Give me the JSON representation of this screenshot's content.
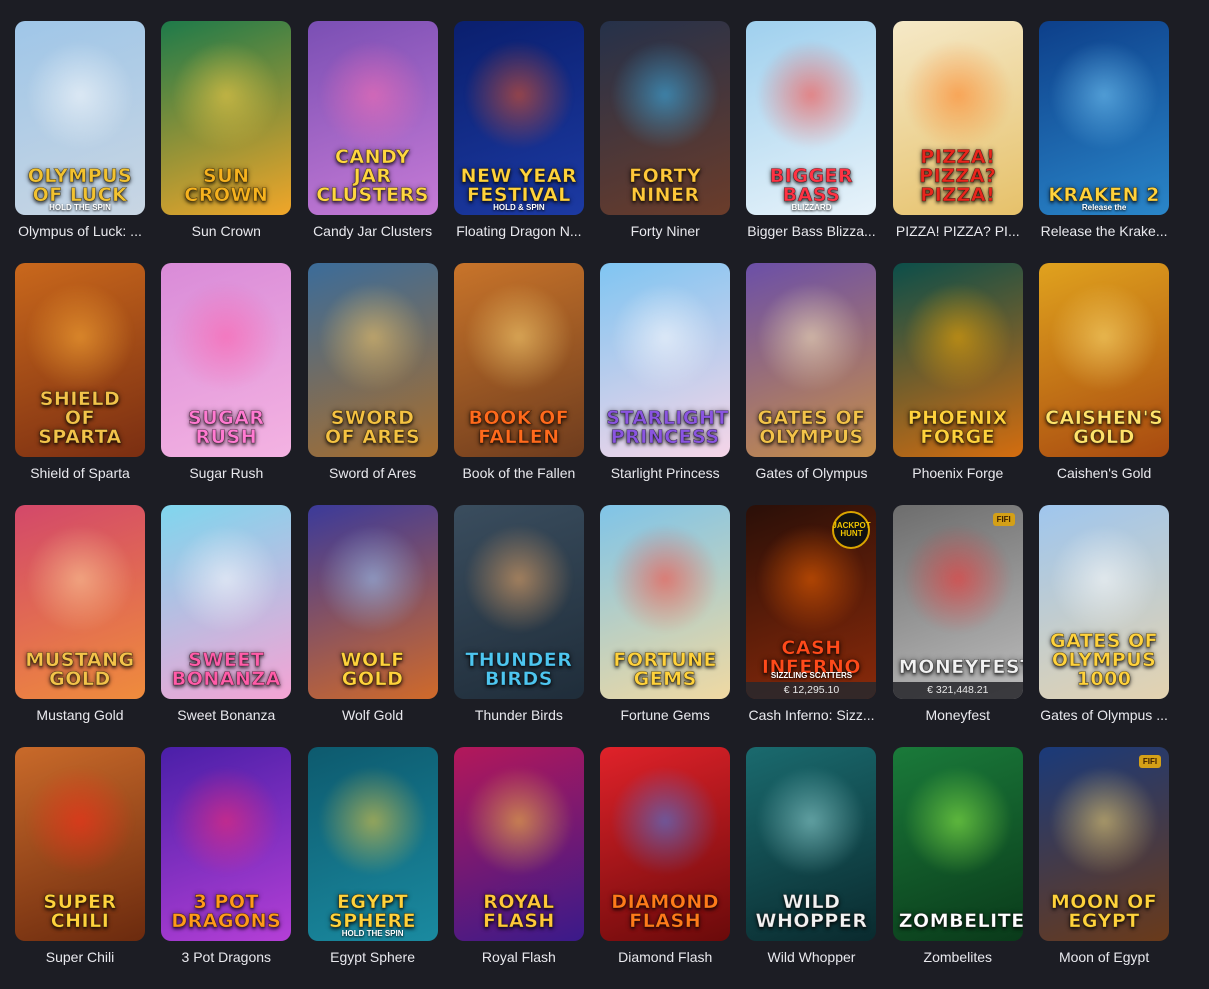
{
  "games": [
    {
      "name": "Olympus of Luck: ...",
      "art": "Olympus\nof Luck",
      "art_sub": "HOLD THE SPIN",
      "bg": [
        "#9fc6e8",
        "#c9d6e3"
      ],
      "glow": "#ffffff",
      "art_color": "#f2c230"
    },
    {
      "name": "Sun Crown",
      "art": "Sun\nCrown",
      "bg": [
        "#1d7a4a",
        "#f1a629"
      ],
      "glow": "#ffd34a",
      "art_color": "#f6b21e"
    },
    {
      "name": "Candy Jar Clusters",
      "art": "Candy\nJar\nClusters",
      "bg": [
        "#7a4fb4",
        "#c77bd6"
      ],
      "glow": "#ff6fb0",
      "art_color": "#ffd640"
    },
    {
      "name": "Floating Dragon N...",
      "art": "New Year\nFestival",
      "art_sub": "HOLD & SPIN",
      "bg": [
        "#0a1f6e",
        "#1c3aa3"
      ],
      "glow": "#ff5a1f",
      "art_color": "#ffd23c"
    },
    {
      "name": "Forty Niner",
      "art": "Forty\nNiner",
      "bg": [
        "#25314a",
        "#6b3c2a"
      ],
      "glow": "#3bc0ff",
      "art_color": "#ffc83a"
    },
    {
      "name": "Bigger Bass Blizza...",
      "art": "Bigger\nBass",
      "art_sub": "BLIZZARD",
      "bg": [
        "#9fd0ee",
        "#e8f3fa"
      ],
      "glow": "#ff3a2e",
      "art_color": "#ff3344"
    },
    {
      "name": "PIZZA! PIZZA? PI...",
      "art": "Pizza!\nPizza?\nPizza!",
      "bg": [
        "#f5e9c8",
        "#e6c16a"
      ],
      "glow": "#ff7a1a",
      "art_color": "#e8261d"
    },
    {
      "name": "Release the Krake...",
      "art": "Kraken 2",
      "art_sub": "Release the",
      "bg": [
        "#0d3f8a",
        "#2a86c9"
      ],
      "glow": "#7fd3ff",
      "art_color": "#ffd23c"
    },
    {
      "name": "Shield of Sparta",
      "art": "Shield\nof\nSparta",
      "bg": [
        "#c9681c",
        "#7a2e12"
      ],
      "glow": "#ffb13a",
      "art_color": "#f3c34a"
    },
    {
      "name": "Sugar Rush",
      "art": "Sugar\nRush",
      "bg": [
        "#d98bd8",
        "#f4b3e2"
      ],
      "glow": "#ff5ca8",
      "art_color": "#ff7ad1"
    },
    {
      "name": "Sword of Ares",
      "art": "Sword\nof Ares",
      "bg": [
        "#3b6c9a",
        "#a86d2c"
      ],
      "glow": "#ffcf6a",
      "art_color": "#f5c242"
    },
    {
      "name": "Book of the Fallen",
      "art": "Book of\nFallen",
      "bg": [
        "#c8742a",
        "#6e3c1e"
      ],
      "glow": "#ffdb7a",
      "art_color": "#ff6a1c"
    },
    {
      "name": "Starlight Princess",
      "art": "Starlight\nPrincess",
      "bg": [
        "#7fc5f2",
        "#f6d5e7"
      ],
      "glow": "#ffffff",
      "art_color": "#8a55e0"
    },
    {
      "name": "Gates of Olympus",
      "art": "Gates of\nOlympus",
      "bg": [
        "#6b4fa8",
        "#c78e48"
      ],
      "glow": "#fff0c2",
      "art_color": "#f3c34a"
    },
    {
      "name": "Phoenix Forge",
      "art": "Phoenix\nForge",
      "bg": [
        "#0b4e4a",
        "#d46d0f"
      ],
      "glow": "#ffb000",
      "art_color": "#ffd23c"
    },
    {
      "name": "Caishen's Gold",
      "art": "Caishen's\nGold",
      "bg": [
        "#e0a21e",
        "#a84a10"
      ],
      "glow": "#ffe27a",
      "art_color": "#ffe36a"
    },
    {
      "name": "Mustang Gold",
      "art": "Mustang\nGold",
      "bg": [
        "#d3486a",
        "#ef8c3c"
      ],
      "glow": "#ffd6a0",
      "art_color": "#f3c34a"
    },
    {
      "name": "Sweet Bonanza",
      "art": "Sweet\nBonanza",
      "bg": [
        "#7fd6ee",
        "#f5a3d4"
      ],
      "glow": "#ffffff",
      "art_color": "#ff5ca8"
    },
    {
      "name": "Wolf Gold",
      "art": "Wolf\nGold",
      "bg": [
        "#3b3a9a",
        "#d06a2a"
      ],
      "glow": "#9fd0ff",
      "art_color": "#ffd23c"
    },
    {
      "name": "Thunder Birds",
      "art": "Thunder\nBirds",
      "bg": [
        "#3a4d5e",
        "#1f2d3a"
      ],
      "glow": "#ffb36a",
      "art_color": "#4ec6f0"
    },
    {
      "name": "Fortune Gems",
      "art": "Fortune\nGems",
      "bg": [
        "#7fc4e8",
        "#f0d9a2"
      ],
      "glow": "#ff3a2e",
      "art_color": "#ffd23c"
    },
    {
      "name": "Cash Inferno: Sizz...",
      "art": "Cash\nInferno",
      "art_sub": "SIZZLING SCATTERS",
      "bg": [
        "#2a0f08",
        "#8a2a0a"
      ],
      "glow": "#ff6a00",
      "art_color": "#ff4a1a",
      "jackpot": "€ 12,295.10",
      "badge": "JACKPOT HUNT"
    },
    {
      "name": "Moneyfest",
      "art": "Moneyfest",
      "bg": [
        "#6d6d6d",
        "#bdbdbd"
      ],
      "glow": "#ff2a2a",
      "art_color": "#f2f2f2",
      "jackpot": "€ 321,448.21",
      "tag": "FIFI"
    },
    {
      "name": "Gates of Olympus ...",
      "art": "Gates of\nOlympus\n1000",
      "bg": [
        "#9fc6ee",
        "#e4d3b0"
      ],
      "glow": "#ffffff",
      "art_color": "#ffd23c"
    },
    {
      "name": "Super Chili",
      "art": "Super\nChili",
      "bg": [
        "#c96a2a",
        "#6b2a0e"
      ],
      "glow": "#ff2a1a",
      "art_color": "#ffd23c"
    },
    {
      "name": "3 Pot Dragons",
      "art": "3 Pot\nDragons",
      "bg": [
        "#4a1fa8",
        "#b43fd6"
      ],
      "glow": "#ff2a6a",
      "art_color": "#ff9a1a"
    },
    {
      "name": "Egypt Sphere",
      "art": "Egypt\nSphere",
      "art_sub": "HOLD THE SPIN",
      "bg": [
        "#0d5a6e",
        "#1a8aa0"
      ],
      "glow": "#ffd23c",
      "art_color": "#ffd23c"
    },
    {
      "name": "Royal Flash",
      "art": "Royal\nFlash",
      "bg": [
        "#b3185a",
        "#3a1a8a"
      ],
      "glow": "#ffd23c",
      "art_color": "#ffc83a"
    },
    {
      "name": "Diamond Flash",
      "art": "Diamond\nFlash",
      "bg": [
        "#e0222a",
        "#6a0a0a"
      ],
      "glow": "#3a8aff",
      "art_color": "#ff7a1a"
    },
    {
      "name": "Wild Whopper",
      "art": "Wild\nWhopper",
      "bg": [
        "#1a6a6e",
        "#0a2a2e"
      ],
      "glow": "#9fe0e0",
      "art_color": "#f2f2f2"
    },
    {
      "name": "Zombelites",
      "art": "Zombelites",
      "bg": [
        "#1a7a3a",
        "#0a3a1a"
      ],
      "glow": "#9bff4a",
      "art_color": "#ffffff"
    },
    {
      "name": "Moon of Egypt",
      "art": "Moon of\nEgypt",
      "bg": [
        "#1a3a7a",
        "#6a3a1a"
      ],
      "glow": "#ffe27a",
      "art_color": "#ffd23c",
      "tag": "FIFI"
    }
  ]
}
